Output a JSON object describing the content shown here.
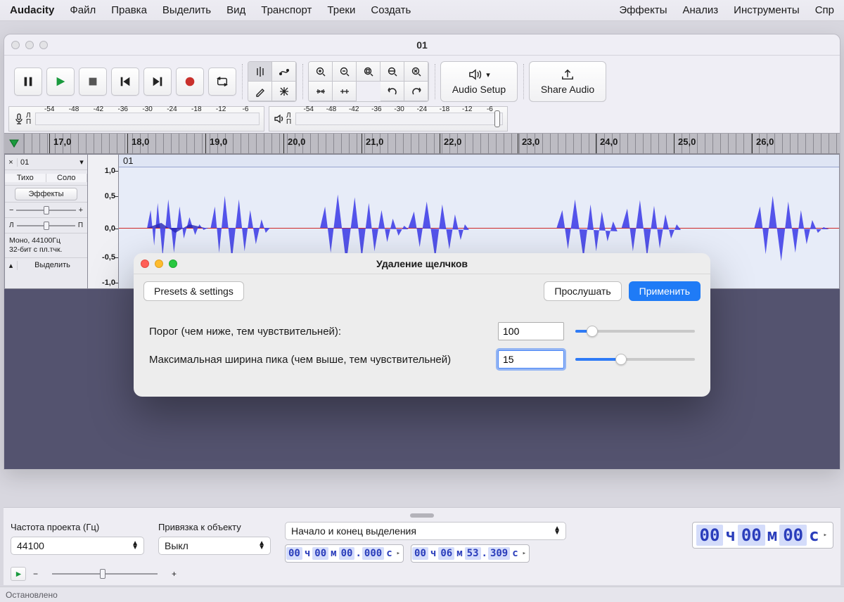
{
  "menubar": {
    "app": "Audacity",
    "left": [
      "Файл",
      "Правка",
      "Выделить",
      "Вид",
      "Транспорт",
      "Треки",
      "Создать"
    ],
    "right": [
      "Эффекты",
      "Анализ",
      "Инструменты",
      "Спр"
    ]
  },
  "window": {
    "title": "01"
  },
  "toolbar": {
    "audio_setup": "Audio Setup",
    "share_audio": "Share Audio"
  },
  "meter": {
    "ticks": [
      "-54",
      "-48",
      "-42",
      "-36",
      "-30",
      "-24",
      "-18",
      "-12",
      "-6"
    ],
    "lp_top": "Л",
    "lp_bot": "П"
  },
  "timeline": {
    "seconds": [
      "17,0",
      "18,0",
      "19,0",
      "20,0",
      "21,0",
      "22,0",
      "23,0",
      "24,0",
      "25,0",
      "26,0"
    ]
  },
  "track": {
    "name": "01",
    "menu_mute": "Тихо",
    "menu_solo": "Соло",
    "effects_btn": "Эффекты",
    "info1": "Моно, 44100Гц",
    "info2": "32-бит с пл.тчк.",
    "select_btn": "Выделить",
    "vscale": [
      "1,0",
      "0,5",
      "0,0",
      "-0,5",
      "-1,0"
    ],
    "clip_label": "01"
  },
  "bottom": {
    "rate_label": "Частота проекта (Гц)",
    "rate_value": "44100",
    "snap_label": "Привязка к объекту",
    "snap_value": "Выкл",
    "sel_mode": "Начало и конец выделения",
    "time_start": {
      "h": "00",
      "m": "00",
      "s": "00",
      "ms": "000",
      "u": "с"
    },
    "time_end": {
      "h": "00",
      "m": "06",
      "s": "53",
      "ms": "309",
      "u": "с"
    },
    "big_time": {
      "h": "00",
      "m": "00",
      "s": "00"
    },
    "hours_u": "ч",
    "min_u": "м",
    "sec_u": "с"
  },
  "status": "Остановлено",
  "dialog": {
    "title": "Удаление щелчков",
    "presets": "Presets & settings",
    "preview": "Прослушать",
    "apply": "Применить",
    "row1_label": "Порог (чем ниже, тем чувствительней):",
    "row1_value": "100",
    "row2_label": "Максимальная ширина пика (чем выше, тем чувствительней)",
    "row2_value": "15"
  }
}
